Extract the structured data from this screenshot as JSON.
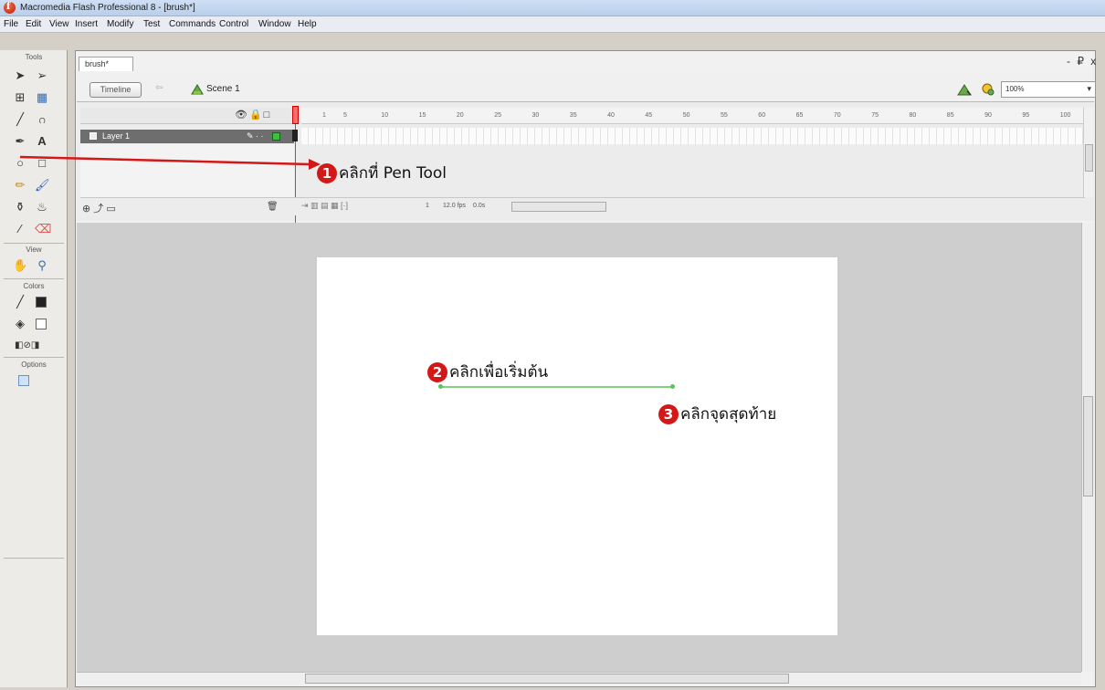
{
  "window": {
    "title": "Macromedia Flash Professional 8 - [brush*]",
    "controls": "- ₽ x"
  },
  "menu": [
    "File",
    "Edit",
    "View",
    "Insert",
    "Modify",
    "Test",
    "Commands",
    "Control",
    "Window",
    "Help"
  ],
  "toolbox": {
    "tools_label": "Tools",
    "view_label": "View",
    "colors_label": "Colors",
    "options_label": "Options"
  },
  "document": {
    "tab": "brush*"
  },
  "editbar": {
    "timeline_label": "Timeline",
    "scene": "Scene 1",
    "zoom": "100%"
  },
  "timeline": {
    "layer_name": "Layer 1",
    "frame_ticks": [
      "1",
      "5",
      "10",
      "15",
      "20",
      "25",
      "30",
      "35",
      "40",
      "45",
      "50",
      "55",
      "60",
      "65",
      "70",
      "75",
      "80",
      "85",
      "90",
      "95",
      "100"
    ],
    "current_frame": "1",
    "fps": "12.0 fps",
    "elapsed": "0.0s"
  },
  "annotations": [
    {
      "num": "1",
      "text": "คลิกที่ Pen Tool"
    },
    {
      "num": "2",
      "text": "คลิกเพื่อเริ่มต้น"
    },
    {
      "num": "3",
      "text": "คลิกจุดสุดท้าย"
    }
  ],
  "colors": {
    "annotation": "#d41818",
    "stroke": "#7fd37f",
    "layer_active": "#6e6e6e"
  },
  "icons": [
    "arrow-tool-icon",
    "subselect-tool-icon",
    "free-transform-icon",
    "fill-transform-icon",
    "line-tool-icon",
    "lasso-tool-icon",
    "pen-tool-icon",
    "text-tool-icon",
    "oval-tool-icon",
    "rectangle-tool-icon",
    "pencil-tool-icon",
    "brush-tool-icon",
    "ink-bottle-icon",
    "paint-bucket-icon",
    "eyedropper-icon",
    "eraser-icon",
    "hand-tool-icon",
    "zoom-tool-icon",
    "stroke-color-icon",
    "fill-color-icon"
  ]
}
